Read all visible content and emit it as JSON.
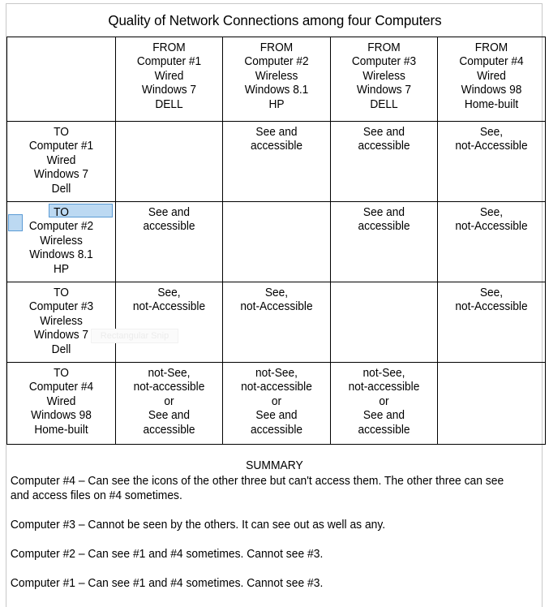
{
  "document": {
    "title": "Quality of Network Connections among four Computers"
  },
  "matrix": {
    "corner_label": "",
    "columns": [
      {
        "direction": "FROM",
        "name": "Computer #1",
        "link": "Wired",
        "os": "Windows 7",
        "maker": "DELL"
      },
      {
        "direction": "FROM",
        "name": "Computer #2",
        "link": "Wireless",
        "os": "Windows 8.1",
        "maker": "HP"
      },
      {
        "direction": "FROM",
        "name": "Computer #3",
        "link": "Wireless",
        "os": "Windows 7",
        "maker": "DELL"
      },
      {
        "direction": "FROM",
        "name": "Computer #4",
        "link": "Wired",
        "os": "Windows 98",
        "maker": "Home-built"
      }
    ],
    "rows": [
      {
        "direction": "TO",
        "name": "Computer #1",
        "link": "Wired",
        "os": "Windows 7",
        "maker": "Dell",
        "cells": [
          "",
          "See and\naccessible",
          "See and\naccessible",
          "See,\nnot-Accessible"
        ]
      },
      {
        "direction": "TO",
        "name": "Computer #2",
        "link": "Wireless",
        "os": "Windows 8.1",
        "maker": "HP",
        "selected": true,
        "cells": [
          "See and\naccessible",
          "",
          "See and\naccessible",
          "See,\nnot-Accessible"
        ]
      },
      {
        "direction": "TO",
        "name": "Computer #3",
        "link": "Wireless",
        "os": "Windows 7",
        "maker": "Dell",
        "cells": [
          "See,\nnot-Accessible",
          "See,\nnot-Accessible",
          "",
          "See,\nnot-Accessible"
        ]
      },
      {
        "direction": "TO",
        "name": "Computer #4",
        "link": "Wired",
        "os": "Windows 98",
        "maker": "Home-built",
        "cells": [
          "not-See,\nnot-accessible\nor\nSee and\naccessible",
          "not-See,\nnot-accessible\nor\nSee and\naccessible",
          "not-See,\nnot-accessible\nor\nSee and\naccessible",
          ""
        ]
      }
    ]
  },
  "artifacts": {
    "ghost_snip_label": "Rectangular Snip",
    "selection_fill_color": "#bcd9f2",
    "selection_border_color": "#5b9bd5"
  },
  "summary": {
    "heading": "SUMMARY",
    "paragraphs": [
      "Computer #4 – Can see the icons of the other three but can't access them. The other three can see and access files on #4 sometimes.",
      "Computer #3 – Cannot be seen by the others. It can see out as well as any.",
      "Computer #2 – Can see #1 and #4 sometimes. Cannot see #3.",
      "Computer #1 – Can see #1 and #4 sometimes. Cannot see #3."
    ]
  }
}
